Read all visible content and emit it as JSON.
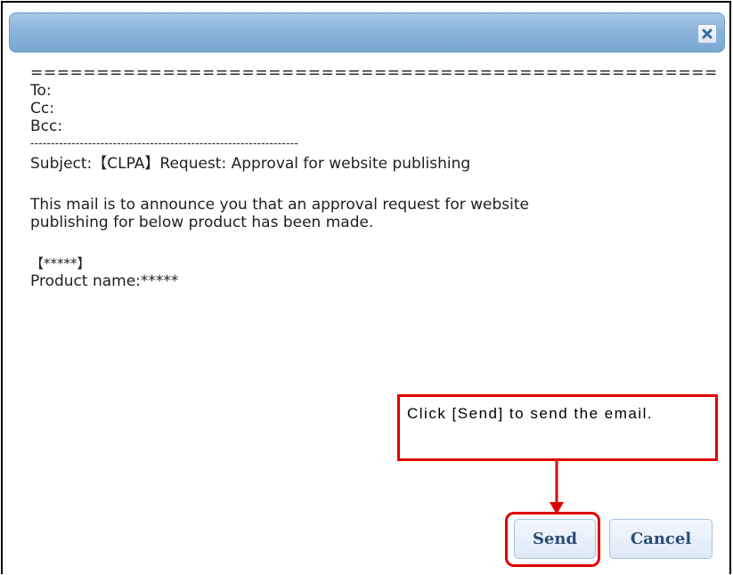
{
  "dialog": {
    "close_icon": "close-icon"
  },
  "email": {
    "separator_eq": "======================================================",
    "to_label": "To:",
    "cc_label": "Cc:",
    "bcc_label": "Bcc:",
    "separator_dash": "-----------------------------------------------------------------",
    "subject_line": "Subject:【CLPA】Request: Approval for website publishing",
    "body_line1": "This mail is to announce you that an approval request for website",
    "body_line2": "publishing for below product has been made.",
    "product_bracket": "【*****】",
    "product_name": "Product name:*****"
  },
  "callout": {
    "text": "Click [Send] to send the email."
  },
  "buttons": {
    "send_label": "Send",
    "cancel_label": "Cancel"
  },
  "colors": {
    "highlight": "#e00000",
    "titlebar": "#8cb4db",
    "button_text": "#2a4d76"
  }
}
